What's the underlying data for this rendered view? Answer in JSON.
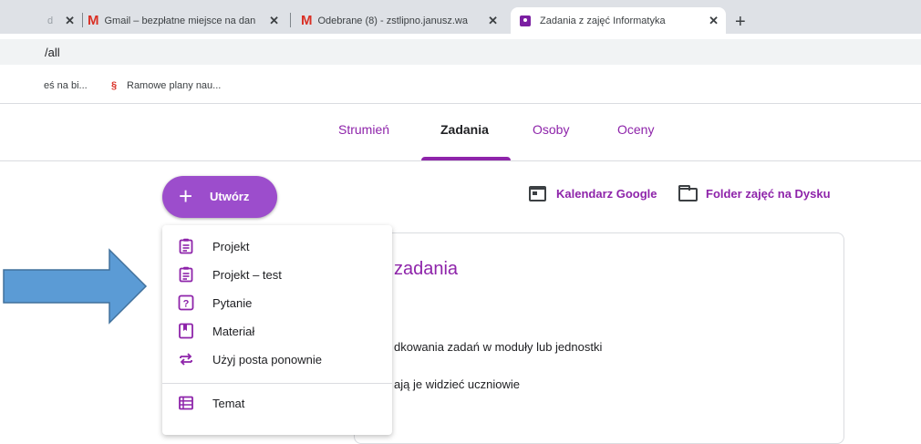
{
  "browser": {
    "tabs": [
      {
        "title": "d",
        "icon": "generic"
      },
      {
        "title": "Gmail – bezpłatne miejsce na dan",
        "icon": "gmail-icon"
      },
      {
        "title": "Odebrane (8) - zstlipno.janusz.wa",
        "icon": "gmail-icon"
      },
      {
        "title": "Zadania z zajęć Informatyka",
        "icon": "classroom-icon"
      }
    ],
    "new_tab": "+",
    "address": "/all",
    "bookmarks": [
      {
        "label": "eś na bi..."
      },
      {
        "label": "Ramowe plany nau...",
        "icon": "§"
      }
    ]
  },
  "nav": {
    "items": [
      "Strumień",
      "Zadania",
      "Osoby",
      "Oceny"
    ],
    "selected": "Zadania"
  },
  "create_button": {
    "label": "Utwórz",
    "icon": "plus-icon"
  },
  "links": {
    "calendar": "Kalendarz Google",
    "drive_folder": "Folder zajęć na Dysku"
  },
  "card": {
    "title": "zadania",
    "line1": "dkowania zadań w moduły lub jednostki",
    "line2": "ają je widzieć uczniowie"
  },
  "menu": {
    "items": [
      {
        "label": "Projekt",
        "icon": "assignment-icon"
      },
      {
        "label": "Projekt – test",
        "icon": "quiz-assignment-icon"
      },
      {
        "label": "Pytanie",
        "icon": "question-icon"
      },
      {
        "label": "Materiał",
        "icon": "material-icon"
      },
      {
        "label": "Użyj posta ponownie",
        "icon": "reuse-icon"
      },
      {
        "label": "Temat",
        "icon": "topic-icon"
      }
    ]
  },
  "colors": {
    "accent": "#8e24aa",
    "create_bg": "#9c4dcc",
    "arrow": "#5b9bd5"
  }
}
